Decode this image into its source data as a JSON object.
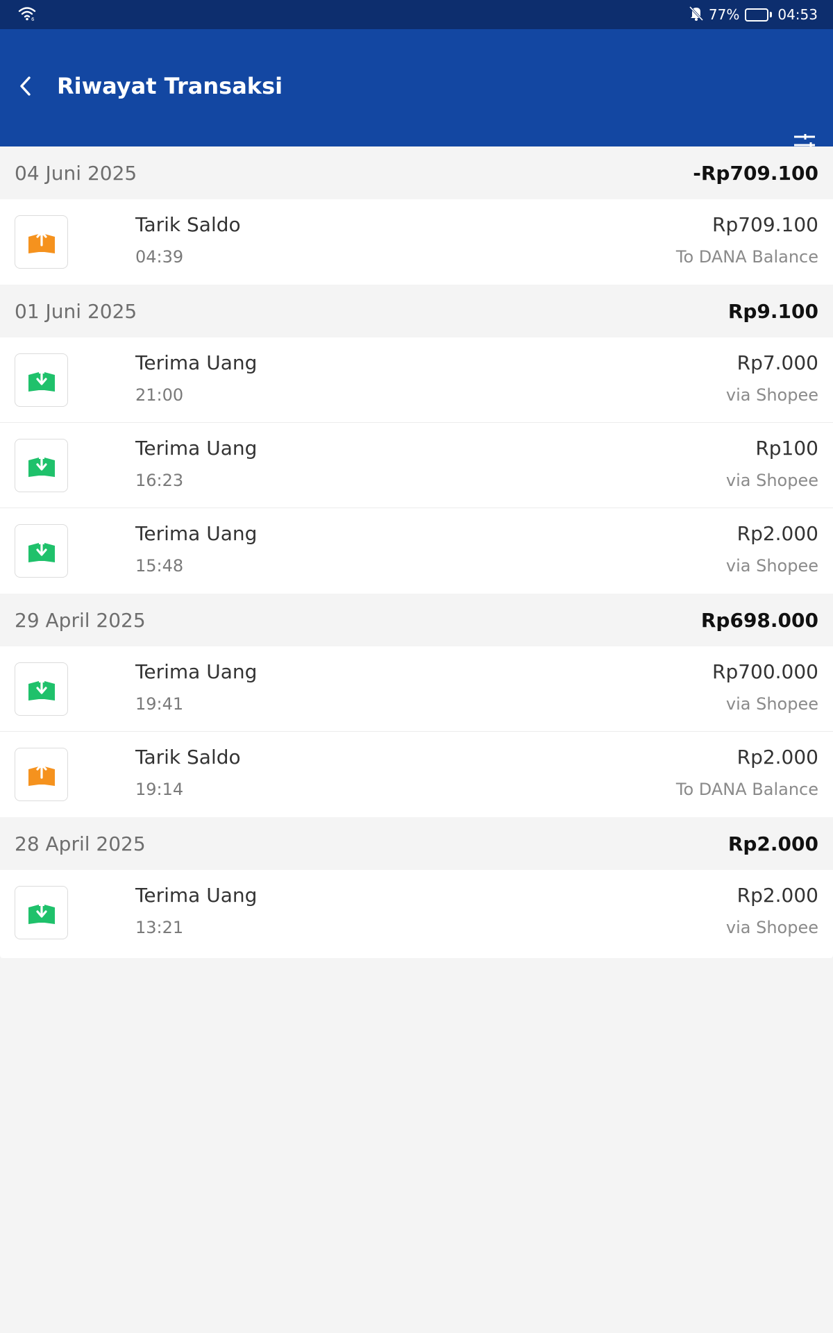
{
  "status_bar": {
    "battery": "77%",
    "time": "04:53",
    "battery_level": 0.77
  },
  "header": {
    "title": "Riwayat Transaksi"
  },
  "colors": {
    "header_bg": "#1347a2",
    "status_bg": "#0d2e6e",
    "withdraw_icon": "#f5921e",
    "receive_icon": "#1fc16b"
  },
  "groups": [
    {
      "date": "04 Juni 2025",
      "total": "-Rp709.100",
      "transactions": [
        {
          "title": "Tarik Saldo",
          "time": "04:39",
          "amount": "Rp709.100",
          "note": "To DANA Balance",
          "icon": "withdraw-icon"
        }
      ]
    },
    {
      "date": "01 Juni 2025",
      "total": "Rp9.100",
      "transactions": [
        {
          "title": "Terima Uang",
          "time": "21:00",
          "amount": "Rp7.000",
          "note": "via Shopee",
          "icon": "receive-money-icon"
        },
        {
          "title": "Terima Uang",
          "time": "16:23",
          "amount": "Rp100",
          "note": "via Shopee",
          "icon": "receive-money-icon"
        },
        {
          "title": "Terima Uang",
          "time": "15:48",
          "amount": "Rp2.000",
          "note": "via Shopee",
          "icon": "receive-money-icon"
        }
      ]
    },
    {
      "date": "29 April 2025",
      "total": "Rp698.000",
      "transactions": [
        {
          "title": "Terima Uang",
          "time": "19:41",
          "amount": "Rp700.000",
          "note": "via Shopee",
          "icon": "receive-money-icon"
        },
        {
          "title": "Tarik Saldo",
          "time": "19:14",
          "amount": "Rp2.000",
          "note": "To DANA Balance",
          "icon": "withdraw-icon"
        }
      ]
    },
    {
      "date": "28 April 2025",
      "total": "Rp2.000",
      "transactions": [
        {
          "title": "Terima Uang",
          "time": "13:21",
          "amount": "Rp2.000",
          "note": "via Shopee",
          "icon": "receive-money-icon"
        }
      ]
    }
  ]
}
